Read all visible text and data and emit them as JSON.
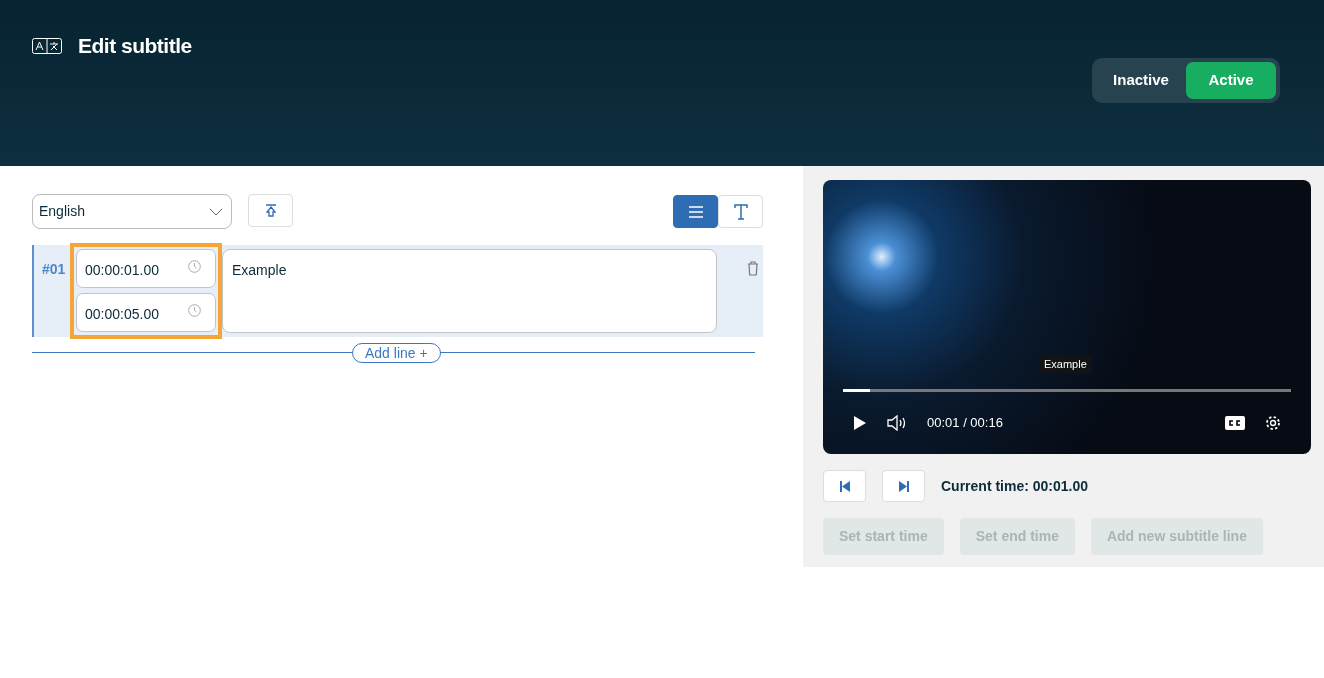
{
  "header": {
    "title": "Edit subtitle",
    "status_options": [
      {
        "label": "Inactive",
        "selected": false
      },
      {
        "label": "Active",
        "selected": true
      }
    ]
  },
  "editor": {
    "language": "English",
    "views": [
      {
        "kind": "list",
        "selected": true
      },
      {
        "kind": "text",
        "selected": false
      }
    ],
    "lines": [
      {
        "number": "#01",
        "start": "00:00:01.00",
        "end": "00:00:05.00",
        "text": "Example",
        "selected": true,
        "times_highlighted": true
      }
    ],
    "add_line": "Add line +"
  },
  "player": {
    "caption": "Example",
    "time": "00:01 / 00:16",
    "progress": {
      "level": 0.06
    },
    "current_time": "Current time: 00:01.00",
    "actions": [
      {
        "label": "Set start time",
        "disabled": true
      },
      {
        "label": "Set end time",
        "disabled": true
      },
      {
        "label": "Add new subtitle line",
        "disabled": true
      }
    ]
  }
}
